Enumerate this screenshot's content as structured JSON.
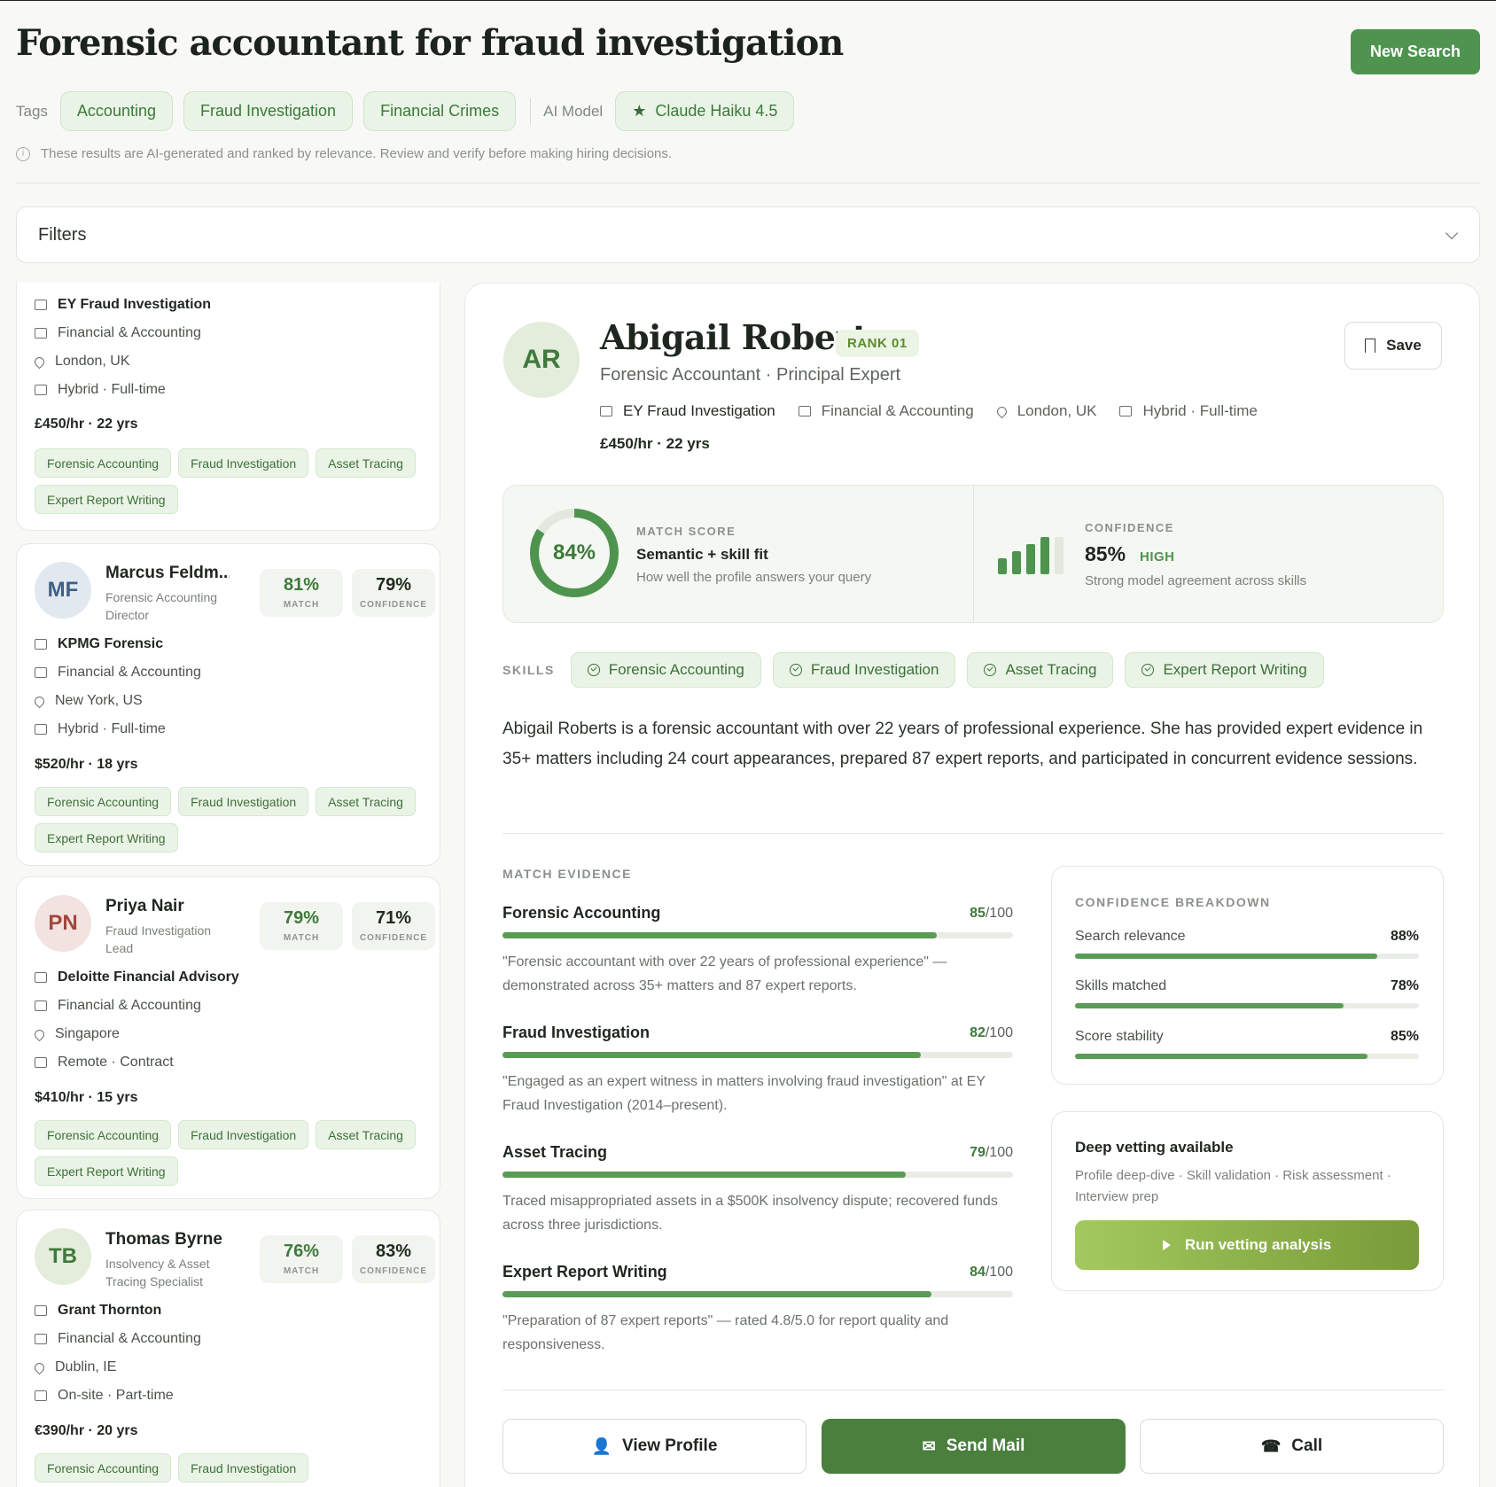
{
  "header": {
    "title": "Forensic accountant for fraud investigation",
    "new_search": "New Search",
    "tags_label": "Tags",
    "tags": [
      "Accounting",
      "Fraud Investigation",
      "Financial Crimes"
    ],
    "model_label": "AI Model",
    "model": "Claude Haiku 4.5",
    "disclaimer": "These results are AI-generated and ranked by relevance. Review and verify before making hiring decisions."
  },
  "filters": {
    "label": "Filters"
  },
  "candidates": [
    {
      "company": "EY Fraud Investigation",
      "industry": "Financial & Accounting",
      "location": "London, UK",
      "work": "Hybrid · Full-time",
      "rate": "£450/hr · 22 yrs",
      "skills": [
        "Forensic Accounting",
        "Fraud Investigation",
        "Asset Tracing",
        "Expert Report Writing"
      ]
    },
    {
      "initials": "MF",
      "name": "Marcus Feldm...",
      "title": "Forensic Accounting Director",
      "match": "81%",
      "confidence": "79%",
      "company": "KPMG Forensic",
      "industry": "Financial & Accounting",
      "location": "New York, US",
      "work": "Hybrid · Full-time",
      "rate": "$520/hr · 18 yrs",
      "skills": [
        "Forensic Accounting",
        "Fraud Investigation",
        "Asset Tracing",
        "Expert Report Writing"
      ]
    },
    {
      "initials": "PN",
      "name": "Priya Nair",
      "title": "Fraud Investigation Lead",
      "match": "79%",
      "confidence": "71%",
      "company": "Deloitte Financial Advisory",
      "industry": "Financial & Accounting",
      "location": "Singapore",
      "work": "Remote · Contract",
      "rate": "$410/hr · 15 yrs",
      "skills": [
        "Forensic Accounting",
        "Fraud Investigation",
        "Asset Tracing",
        "Expert Report Writing"
      ]
    },
    {
      "initials": "TB",
      "name": "Thomas Byrne",
      "title": "Insolvency & Asset Tracing Specialist",
      "match": "76%",
      "confidence": "83%",
      "company": "Grant Thornton",
      "industry": "Financial & Accounting",
      "location": "Dublin, IE",
      "work": "On-site · Part-time",
      "rate": "€390/hr · 20 yrs",
      "skills": [
        "Forensic Accounting",
        "Fraud Investigation"
      ]
    }
  ],
  "score_labels": {
    "match": "MATCH",
    "confidence": "CONFIDENCE"
  },
  "detail": {
    "initials": "AR",
    "name": "Abigail Roberts",
    "rank": "RANK 01",
    "save": "Save",
    "subtitle": "Forensic Accountant · Principal Expert",
    "company": "EY Fraud Investigation",
    "industry": "Financial & Accounting",
    "location": "London, UK",
    "work": "Hybrid · Full-time",
    "rate": "£450/hr · 22 yrs",
    "match_score": {
      "value": "84%",
      "fraction": 0.84,
      "label": "MATCH SCORE",
      "main": "Semantic + skill fit",
      "desc": "How well the profile answers your query"
    },
    "confidence": {
      "label": "CONFIDENCE",
      "value": "85%",
      "level": "HIGH",
      "desc": "Strong model agreement across skills"
    },
    "skills_label": "SKILLS",
    "skills": [
      "Forensic Accounting",
      "Fraud Investigation",
      "Asset Tracing",
      "Expert Report Writing"
    ],
    "bio": "Abigail Roberts is a forensic accountant with over 22 years of professional experience. She has provided expert evidence in 35+ matters including 24 court appearances, prepared 87 expert reports, and participated in concurrent evidence sessions.",
    "match_evidence_label": "MATCH EVIDENCE",
    "evidence": [
      {
        "name": "Forensic Accounting",
        "score": "85",
        "max": "/100",
        "quote": "\"Forensic accountant with over 22 years of professional experience\" — demonstrated across 35+ matters and 87 expert reports."
      },
      {
        "name": "Fraud Investigation",
        "score": "82",
        "max": "/100",
        "quote": "\"Engaged as an expert witness in matters involving fraud investigation\" at EY Fraud Investigation (2014–present)."
      },
      {
        "name": "Asset Tracing",
        "score": "79",
        "max": "/100",
        "quote": "Traced misappropriated assets in a $500K insolvency dispute; recovered funds across three jurisdictions."
      },
      {
        "name": "Expert Report Writing",
        "score": "84",
        "max": "/100",
        "quote": "\"Preparation of 87 expert reports\" — rated 4.8/5.0 for report quality and responsiveness."
      }
    ],
    "breakdown_label": "CONFIDENCE BREAKDOWN",
    "breakdown": [
      {
        "name": "Search relevance",
        "value": "88%",
        "fraction": 0.88
      },
      {
        "name": "Skills matched",
        "value": "78%",
        "fraction": 0.78
      },
      {
        "name": "Score stability",
        "value": "85%",
        "fraction": 0.85
      }
    ],
    "vetting": {
      "title": "Deep vetting available",
      "desc": "Profile deep-dive · Skill validation · Risk assessment · Interview prep",
      "button": "Run vetting analysis"
    },
    "actions": {
      "view_profile": "View Profile",
      "send_mail": "Send Mail",
      "call": "Call"
    }
  },
  "colors": {
    "accent": "#4e944f",
    "pill_bg": "#eaf4e6",
    "primary_button": "#4a7f3e"
  }
}
